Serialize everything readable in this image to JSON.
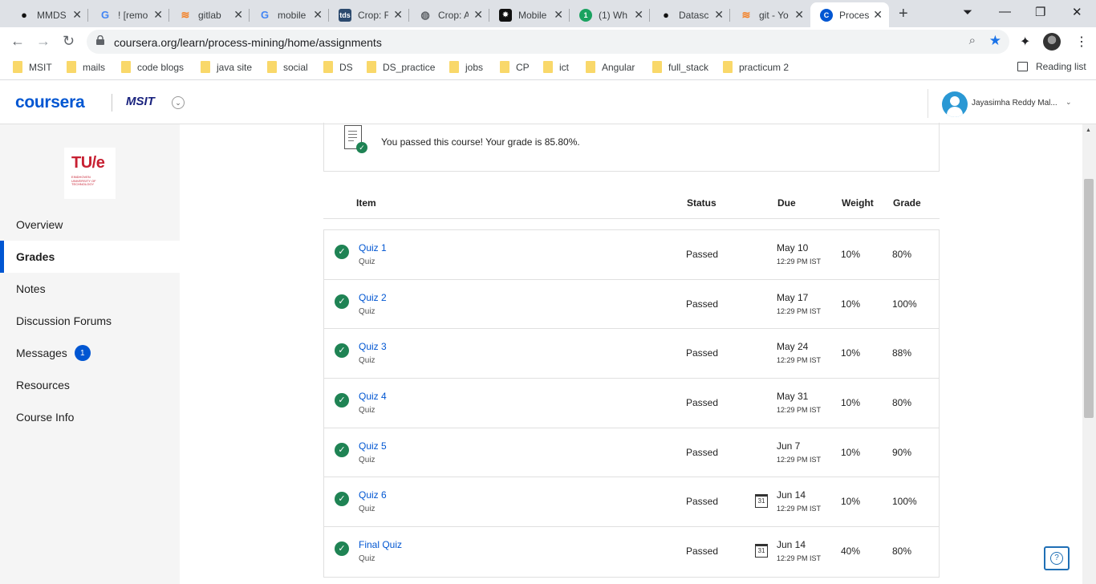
{
  "browser": {
    "tabs": [
      {
        "title": "MMDS",
        "icon": "github-icon",
        "color": "#111111",
        "glyph": "●"
      },
      {
        "title": "! [remo",
        "icon": "google-icon",
        "color": "#4285f4",
        "glyph": "G"
      },
      {
        "title": "gitlab",
        "icon": "stackoverflow-icon",
        "color": "#f48024",
        "glyph": "≋"
      },
      {
        "title": "mobile",
        "icon": "google-icon",
        "color": "#4285f4",
        "glyph": "G"
      },
      {
        "title": "Crop: F",
        "icon": "tds-icon",
        "color": "#2c4a6e",
        "glyph": "tds"
      },
      {
        "title": "Crop: A",
        "icon": "globe-icon",
        "color": "#5f6368",
        "glyph": "◍"
      },
      {
        "title": "Mobile",
        "icon": "app-icon",
        "color": "#111111",
        "glyph": "✸"
      },
      {
        "title": "(1) Wh",
        "icon": "notification-icon",
        "color": "#1aa260",
        "glyph": "1"
      },
      {
        "title": "Datasc",
        "icon": "github-icon",
        "color": "#111111",
        "glyph": "●"
      },
      {
        "title": "git - Yo",
        "icon": "stackoverflow-icon",
        "color": "#f48024",
        "glyph": "≋"
      },
      {
        "title": "Proces",
        "icon": "coursera-icon",
        "color": "#0056d2",
        "glyph": "C",
        "active": true
      }
    ],
    "url": "coursera.org/learn/process-mining/home/assignments",
    "bookmarks": [
      "MSIT",
      "mails",
      "code blogs",
      "java site",
      "social",
      "DS",
      "DS_practice",
      "jobs",
      "CP",
      "ict",
      "Angular",
      "full_stack",
      "practicum 2"
    ],
    "reading_list": "Reading list"
  },
  "header": {
    "logo": "coursera",
    "org": "MSIT",
    "user": "Jayasimha Reddy Mal..."
  },
  "sidebar": {
    "university_logo": "TU/e",
    "university_sub": "EINDHOVEN UNIVERSITY OF TECHNOLOGY",
    "items": [
      {
        "label": "Overview"
      },
      {
        "label": "Grades",
        "active": true
      },
      {
        "label": "Notes"
      },
      {
        "label": "Discussion Forums"
      },
      {
        "label": "Messages",
        "badge": "1"
      },
      {
        "label": "Resources"
      },
      {
        "label": "Course Info"
      }
    ]
  },
  "main": {
    "passed_message": "You passed this course! Your grade is 85.80%.",
    "columns": {
      "item": "Item",
      "status": "Status",
      "due": "Due",
      "weight": "Weight",
      "grade": "Grade"
    },
    "rows": [
      {
        "name": "Quiz 1",
        "type": "Quiz",
        "status": "Passed",
        "due_date": "May 10",
        "due_time": "12:29 PM IST",
        "weight": "10%",
        "grade": "80%",
        "calendar": false
      },
      {
        "name": "Quiz 2",
        "type": "Quiz",
        "status": "Passed",
        "due_date": "May 17",
        "due_time": "12:29 PM IST",
        "weight": "10%",
        "grade": "100%",
        "calendar": false
      },
      {
        "name": "Quiz 3",
        "type": "Quiz",
        "status": "Passed",
        "due_date": "May 24",
        "due_time": "12:29 PM IST",
        "weight": "10%",
        "grade": "88%",
        "calendar": false
      },
      {
        "name": "Quiz 4",
        "type": "Quiz",
        "status": "Passed",
        "due_date": "May 31",
        "due_time": "12:29 PM IST",
        "weight": "10%",
        "grade": "80%",
        "calendar": false
      },
      {
        "name": "Quiz 5",
        "type": "Quiz",
        "status": "Passed",
        "due_date": "Jun 7",
        "due_time": "12:29 PM IST",
        "weight": "10%",
        "grade": "90%",
        "calendar": false
      },
      {
        "name": "Quiz 6",
        "type": "Quiz",
        "status": "Passed",
        "due_date": "Jun 14",
        "due_time": "12:29 PM IST",
        "weight": "10%",
        "grade": "100%",
        "calendar": true
      },
      {
        "name": "Final Quiz",
        "type": "Quiz",
        "status": "Passed",
        "due_date": "Jun 14",
        "due_time": "12:29 PM IST",
        "weight": "40%",
        "grade": "80%",
        "calendar": true
      }
    ],
    "calendar_day": "31",
    "help": "?"
  },
  "colors": {
    "accent": "#0056d2",
    "success": "#1f8354"
  }
}
